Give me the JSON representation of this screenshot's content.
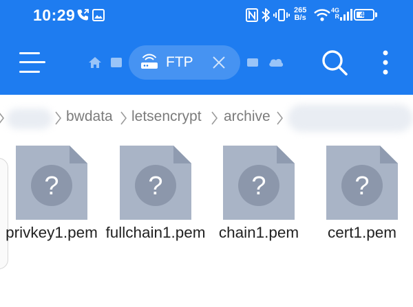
{
  "status_bar": {
    "time": "10:29",
    "network_speed_value": "265",
    "network_speed_unit": "B/s",
    "signal_type": "4G",
    "signal_sub": "R",
    "battery_level": "41",
    "icons": [
      "call-forward-icon",
      "image-icon",
      "nfc-icon",
      "bluetooth-icon",
      "vibrate-icon",
      "wifi-icon",
      "signal-icon",
      "battery-icon"
    ]
  },
  "toolbar": {
    "tab_label": "FTP",
    "icons": [
      "menu-icon",
      "home-icon",
      "book-icon",
      "router-icon",
      "close-icon",
      "device-icon",
      "cloud-icon",
      "search-icon",
      "more-icon"
    ]
  },
  "breadcrumbs": [
    "bwdata",
    "letsencrypt",
    "archive"
  ],
  "files": [
    {
      "name": "privkey1.pem",
      "icon": "unknown-file-icon"
    },
    {
      "name": "fullchain1.pem",
      "icon": "unknown-file-icon"
    },
    {
      "name": "chain1.pem",
      "icon": "unknown-file-icon"
    },
    {
      "name": "cert1.pem",
      "icon": "unknown-file-icon"
    }
  ],
  "colors": {
    "accent": "#1e7cf0",
    "file_icon": "#a9b4c6",
    "file_fold": "#8f9bb0",
    "file_circle": "#8c97ab",
    "breadcrumb_text": "#7b7b7b"
  }
}
